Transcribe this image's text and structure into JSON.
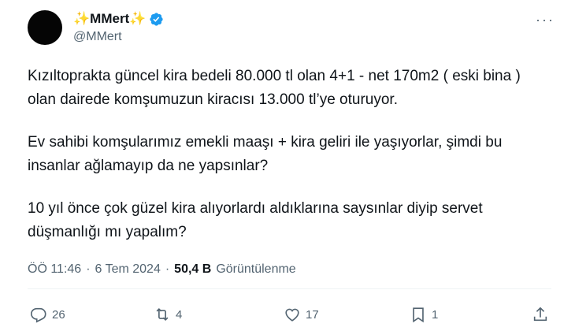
{
  "author": {
    "display_name": "✨MMert✨",
    "handle": "@MMert"
  },
  "tweet": {
    "paragraphs": [
      "Kızıltoprakta güncel kira bedeli 80.000 tl olan 4+1 - net 170m2 ( eski bina ) olan dairede komşumuzun kiracısı 13.000 tl’ye oturuyor.",
      "Ev sahibi komşularımız emekli maaşı + kira geliri ile yaşıyorlar, şimdi bu insanlar ağlamayıp da ne yapsınlar?",
      "10 yıl önce çok güzel kira alıyorlardı aldıklarına saysınlar diyip servet düşmanlığı mı yapalım?"
    ],
    "time": "ÖÖ 11:46",
    "separator": "·",
    "date": "6 Tem 2024",
    "views_count": "50,4 B",
    "views_label": "Görüntülenme"
  },
  "actions": {
    "replies": "26",
    "reposts": "4",
    "likes": "17",
    "bookmarks": "1"
  },
  "colors": {
    "text": "#0f1419",
    "secondary": "#536471",
    "verified": "#1d9bf0"
  }
}
